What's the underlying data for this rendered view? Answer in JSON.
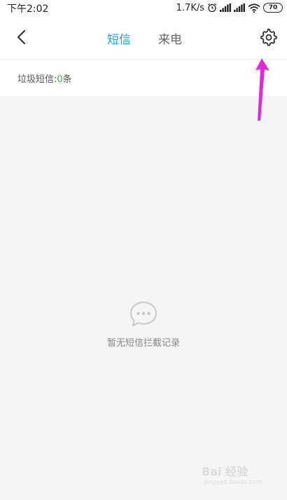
{
  "status_bar": {
    "time": "下午2:02",
    "net_speed": "1.7K/s",
    "battery": "70"
  },
  "header": {
    "tabs": [
      {
        "label": "短信",
        "active": true
      },
      {
        "label": "来电",
        "active": false
      }
    ],
    "icons": {
      "back": "chevron-left-icon",
      "settings": "gear-icon"
    }
  },
  "spam": {
    "label": "垃圾短信:",
    "count": "0",
    "unit": "条"
  },
  "empty_state": {
    "icon": "chat-bubble-icon",
    "text": "暂无短信拦截记录"
  },
  "watermark": {
    "brand": "Bai 经验",
    "url": "jingyan.baidu.com"
  },
  "colors": {
    "accent": "#1aa3e8",
    "count_green": "#4cb050",
    "annotation_arrow": "#e628d8"
  }
}
